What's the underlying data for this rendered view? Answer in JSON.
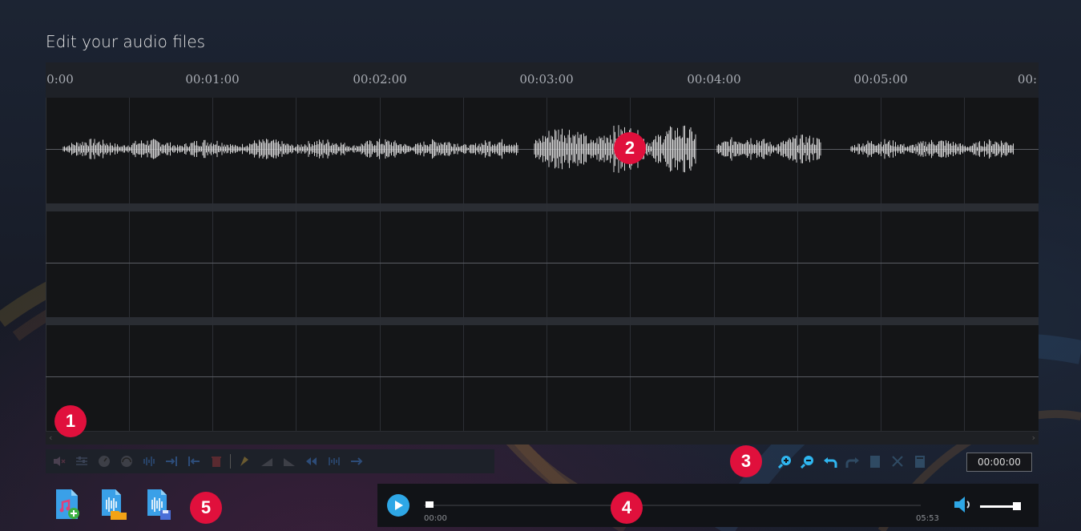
{
  "title": "Edit your audio files",
  "ruler": {
    "ticks": [
      "0:00",
      "00:01:00",
      "00:02:00",
      "00:03:00",
      "00:04:00",
      "00:05:00",
      "00:"
    ]
  },
  "toolbar": {
    "icons": [
      "mute-icon",
      "equalizer-icon",
      "speed-icon",
      "pitch-icon",
      "normalize-icon",
      "trim-right-icon",
      "trim-left-icon",
      "delete-icon",
      "noise-icon",
      "fade-in-icon",
      "fade-out-icon",
      "reverse-icon",
      "split-icon",
      "insert-icon"
    ]
  },
  "right_tools": {
    "icons": [
      "zoom-in-icon",
      "zoom-out-icon",
      "undo-icon",
      "redo-icon",
      "paste-icon",
      "cut-icon",
      "copy-icon"
    ],
    "time_value": "00:00:00"
  },
  "player": {
    "current_time": "00:00",
    "duration": "05:53",
    "progress": 0.0,
    "volume": 0.9
  },
  "file_buttons": [
    "add-audio-icon",
    "open-file-icon",
    "save-file-icon"
  ],
  "badges": [
    "1",
    "2",
    "3",
    "4",
    "5"
  ],
  "colors": {
    "accent": "#2ea7e6",
    "badge": "#e0103c",
    "waveform": "#d8d8d8"
  }
}
